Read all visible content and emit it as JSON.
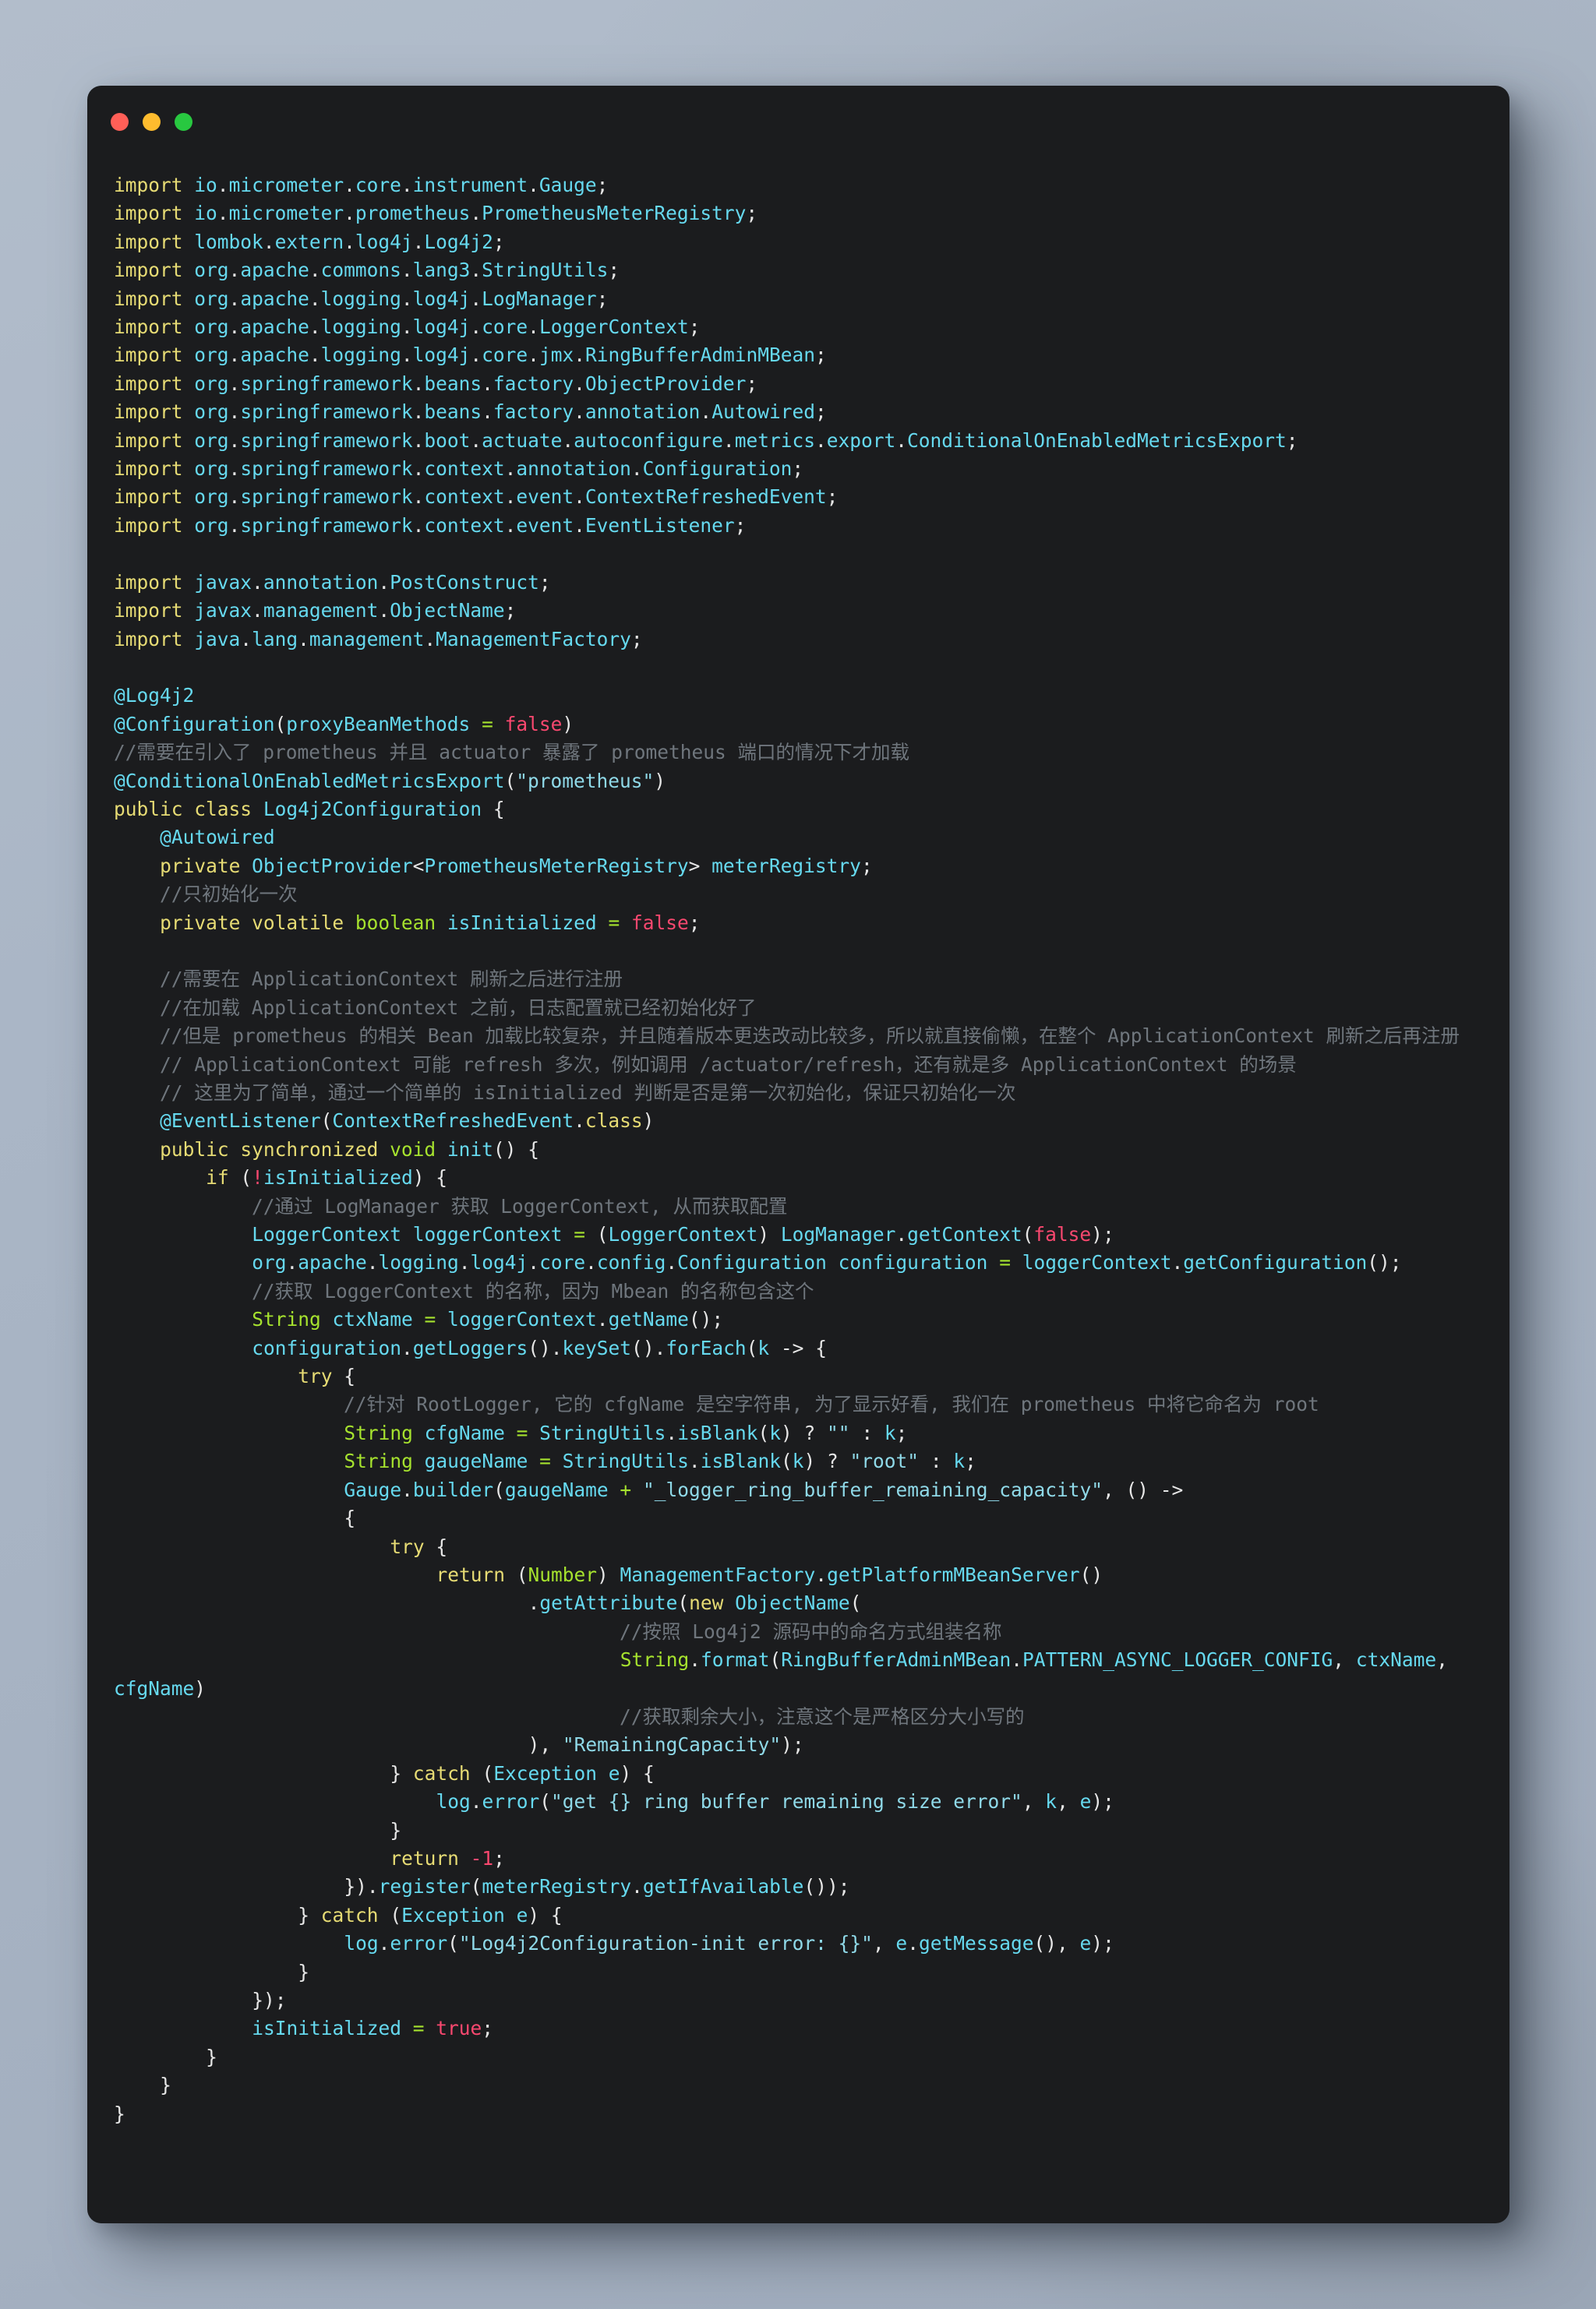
{
  "window": {
    "background_color": "#1b1c1e",
    "page_background_color": "#aab6c6",
    "traffic_lights": [
      {
        "name": "close",
        "color": "#ff5f57"
      },
      {
        "name": "minimize",
        "color": "#febc2e"
      },
      {
        "name": "maximize",
        "color": "#28c840"
      }
    ]
  },
  "theme": {
    "keyword": "#e6db74",
    "type": "#a6e22e",
    "identifier": "#66d9ef",
    "string": "#8fd9e8",
    "literal": "#f9486f",
    "comment": "#6f767d",
    "plain": "#e6e6e6"
  },
  "code": {
    "language": "java",
    "class_name": "Log4j2Configuration",
    "lines": [
      "import io.micrometer.core.instrument.Gauge;",
      "import io.micrometer.prometheus.PrometheusMeterRegistry;",
      "import lombok.extern.log4j.Log4j2;",
      "import org.apache.commons.lang3.StringUtils;",
      "import org.apache.logging.log4j.LogManager;",
      "import org.apache.logging.log4j.core.LoggerContext;",
      "import org.apache.logging.log4j.core.jmx.RingBufferAdminMBean;",
      "import org.springframework.beans.factory.ObjectProvider;",
      "import org.springframework.beans.factory.annotation.Autowired;",
      "import org.springframework.boot.actuate.autoconfigure.metrics.export.ConditionalOnEnabledMetricsExport;",
      "import org.springframework.context.annotation.Configuration;",
      "import org.springframework.context.event.ContextRefreshedEvent;",
      "import org.springframework.context.event.EventListener;",
      "",
      "import javax.annotation.PostConstruct;",
      "import javax.management.ObjectName;",
      "import java.lang.management.ManagementFactory;",
      "",
      "@Log4j2",
      "@Configuration(proxyBeanMethods = false)",
      "//需要在引入了 prometheus 并且 actuator 暴露了 prometheus 端口的情况下才加载",
      "@ConditionalOnEnabledMetricsExport(\"prometheus\")",
      "public class Log4j2Configuration {",
      "    @Autowired",
      "    private ObjectProvider<PrometheusMeterRegistry> meterRegistry;",
      "    //只初始化一次",
      "    private volatile boolean isInitialized = false;",
      "",
      "    //需要在 ApplicationContext 刷新之后进行注册",
      "    //在加载 ApplicationContext 之前，日志配置就已经初始化好了",
      "    //但是 prometheus 的相关 Bean 加载比较复杂，并且随着版本更迭改动比较多，所以就直接偷懒，在整个 ApplicationContext 刷新之后再注册",
      "    // ApplicationContext 可能 refresh 多次，例如调用 /actuator/refresh，还有就是多 ApplicationContext 的场景",
      "    // 这里为了简单，通过一个简单的 isInitialized 判断是否是第一次初始化，保证只初始化一次",
      "    @EventListener(ContextRefreshedEvent.class)",
      "    public synchronized void init() {",
      "        if (!isInitialized) {",
      "            //通过 LogManager 获取 LoggerContext, 从而获取配置",
      "            LoggerContext loggerContext = (LoggerContext) LogManager.getContext(false);",
      "            org.apache.logging.log4j.core.config.Configuration configuration = loggerContext.getConfiguration();",
      "            //获取 LoggerContext 的名称，因为 Mbean 的名称包含这个",
      "            String ctxName = loggerContext.getName();",
      "            configuration.getLoggers().keySet().forEach(k -> {",
      "                try {",
      "                    //针对 RootLogger, 它的 cfgName 是空字符串, 为了显示好看, 我们在 prometheus 中将它命名为 root",
      "                    String cfgName = StringUtils.isBlank(k) ? \"\" : k;",
      "                    String gaugeName = StringUtils.isBlank(k) ? \"root\" : k;",
      "                    Gauge.builder(gaugeName + \"_logger_ring_buffer_remaining_capacity\", () ->",
      "                    {",
      "                        try {",
      "                            return (Number) ManagementFactory.getPlatformMBeanServer()",
      "                                    .getAttribute(new ObjectName(",
      "                                            //按照 Log4j2 源码中的命名方式组装名称",
      "                                            String.format(RingBufferAdminMBean.PATTERN_ASYNC_LOGGER_CONFIG, ctxName, cfgName)",
      "                                            //获取剩余大小，注意这个是严格区分大小写的",
      "                                    ), \"RemainingCapacity\");",
      "                        } catch (Exception e) {",
      "                            log.error(\"get {} ring buffer remaining size error\", k, e);",
      "                        }",
      "                        return -1;",
      "                    }).register(meterRegistry.getIfAvailable());",
      "                } catch (Exception e) {",
      "                    log.error(\"Log4j2Configuration-init error: {}\", e.getMessage(), e);",
      "                }",
      "            });",
      "            isInitialized = true;",
      "        }",
      "    }",
      "}"
    ]
  }
}
